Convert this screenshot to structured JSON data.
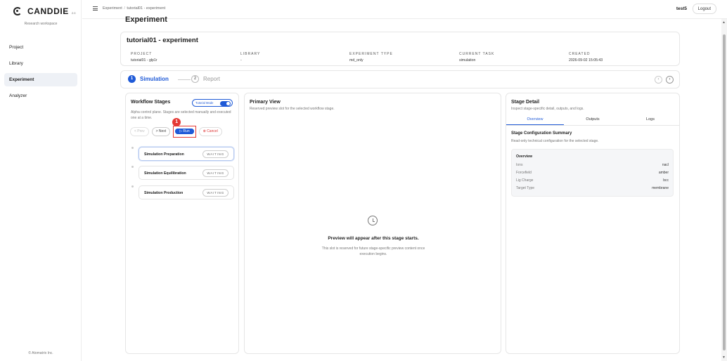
{
  "brand": {
    "name": "CANDDIE",
    "version": "2.0",
    "workspace": "Research workspace",
    "copyright": "© Atomatrix Inc."
  },
  "nav": {
    "items": [
      {
        "label": "Project"
      },
      {
        "label": "Library"
      },
      {
        "label": "Experiment",
        "active": true
      },
      {
        "label": "Analyzer"
      }
    ]
  },
  "topbar": {
    "breadcrumb": [
      "Experiment",
      "tutorial01 - experiment"
    ],
    "username": "test5",
    "logout": "Logout"
  },
  "page": {
    "title": "Experiment"
  },
  "experiment": {
    "name": "tutorial01 - experiment",
    "meta": [
      {
        "label": "PROJECT",
        "value": "tutorial01 - glp1r"
      },
      {
        "label": "LIBRARY",
        "value": "-"
      },
      {
        "label": "EXPERIMENT TYPE",
        "value": "md_only"
      },
      {
        "label": "CURRENT TASK",
        "value": "simulation"
      },
      {
        "label": "CREATED",
        "value": "2026-09-02 15:05:43"
      }
    ]
  },
  "stepper": {
    "steps": [
      {
        "num": "1",
        "label": "Simulation",
        "active": true
      },
      {
        "num": "2",
        "label": "Report",
        "active": false
      }
    ],
    "prev_icon": "chevron-left-icon",
    "next_icon": "chevron-right-icon"
  },
  "workflow": {
    "title": "Workflow Stages",
    "tutorial_label": "Tutorial Mode",
    "tutorial_on": true,
    "description": "Alpha control plane. Stages are selected manually and executed one at a time.",
    "buttons": {
      "prev": "< Prev",
      "next": "> Next",
      "run": "▷ Run",
      "cancel": "⊗ Cancel"
    },
    "annotation_badge": "1",
    "stages": [
      {
        "name": "Simulation Preparation",
        "status": "WAITING",
        "selected": true
      },
      {
        "name": "Simulation Equilibration",
        "status": "WAITING",
        "selected": false
      },
      {
        "name": "Simulation Production",
        "status": "WAITING",
        "selected": false
      }
    ]
  },
  "primary": {
    "title": "Primary View",
    "subtitle": "Reserved preview slot for the selected workflow stage.",
    "empty_title": "Preview will appear after this stage starts.",
    "empty_desc": "This slot is reserved for future stage-specific preview content once execution begins."
  },
  "detail": {
    "title": "Stage Detail",
    "subtitle": "Inspect stage-specific detail, outputs, and logs.",
    "tabs": [
      {
        "label": "Overview",
        "active": true
      },
      {
        "label": "Outputs"
      },
      {
        "label": "Logs"
      }
    ],
    "summary_title": "Stage Configuration Summary",
    "summary_sub": "Read-only technical configuration for the selected stage.",
    "overview_title": "Overview",
    "rows": [
      {
        "key": "Ions",
        "value": "nacl"
      },
      {
        "key": "Forcefield",
        "value": "amber"
      },
      {
        "key": "Lig Charge",
        "value": "bcc"
      },
      {
        "key": "Target Type",
        "value": "membrane"
      }
    ]
  },
  "colors": {
    "accent": "#1f5ad7",
    "highlight": "#e53935"
  }
}
